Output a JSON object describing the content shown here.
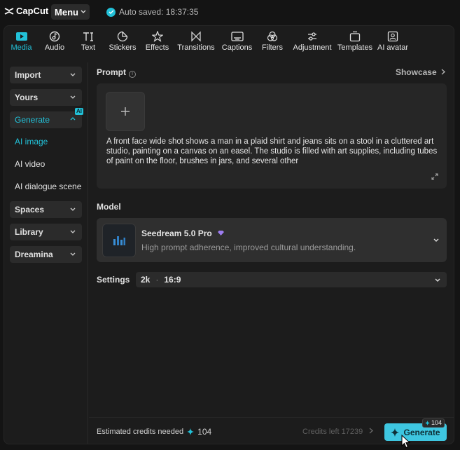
{
  "app": {
    "logo_text": "CapCut",
    "menu_label": "Menu",
    "autosave_text": "Auto saved: 18:37:35"
  },
  "toolbar": {
    "items": [
      {
        "label": "Media",
        "icon": "media-icon",
        "active": true
      },
      {
        "label": "Audio",
        "icon": "audio-icon"
      },
      {
        "label": "Text",
        "icon": "text-icon"
      },
      {
        "label": "Stickers",
        "icon": "stickers-icon"
      },
      {
        "label": "Effects",
        "icon": "effects-icon"
      },
      {
        "label": "Transitions",
        "icon": "transitions-icon"
      },
      {
        "label": "Captions",
        "icon": "captions-icon"
      },
      {
        "label": "Filters",
        "icon": "filters-icon"
      },
      {
        "label": "Adjustment",
        "icon": "adjustment-icon"
      },
      {
        "label": "Templates",
        "icon": "templates-icon"
      },
      {
        "label": "AI avatar",
        "icon": "ai-avatar-icon"
      }
    ]
  },
  "sidebar": {
    "import": "Import",
    "yours": "Yours",
    "generate": "Generate",
    "generate_badge": "AI",
    "sub": {
      "ai_image": "AI image",
      "ai_video": "AI video",
      "ai_dialogue": "AI dialogue scene"
    },
    "spaces": "Spaces",
    "library": "Library",
    "dreamina": "Dreamina"
  },
  "prompt": {
    "label": "Prompt",
    "showcase": "Showcase",
    "text": "A front face wide shot shows a man in a plaid shirt and jeans sits on a stool in a cluttered art studio, painting on a canvas on an easel. The studio is filled with art supplies, including tubes of paint on the floor, brushes in jars, and several other"
  },
  "model": {
    "label": "Model",
    "name": "Seedream 5.0 Pro",
    "description": "High prompt adherence, improved cultural understanding."
  },
  "settings": {
    "label": "Settings",
    "resolution": "2k",
    "aspect": "16:9"
  },
  "footer": {
    "estimated_label": "Estimated credits needed",
    "estimated_value": "104",
    "credits_left": "Credits left 17239",
    "generate_label": "Generate",
    "badge_value": "104"
  },
  "colors": {
    "accent": "#22c1d8",
    "generate_bg": "#3ec6e0",
    "panel_bg": "#1c1c1c"
  }
}
